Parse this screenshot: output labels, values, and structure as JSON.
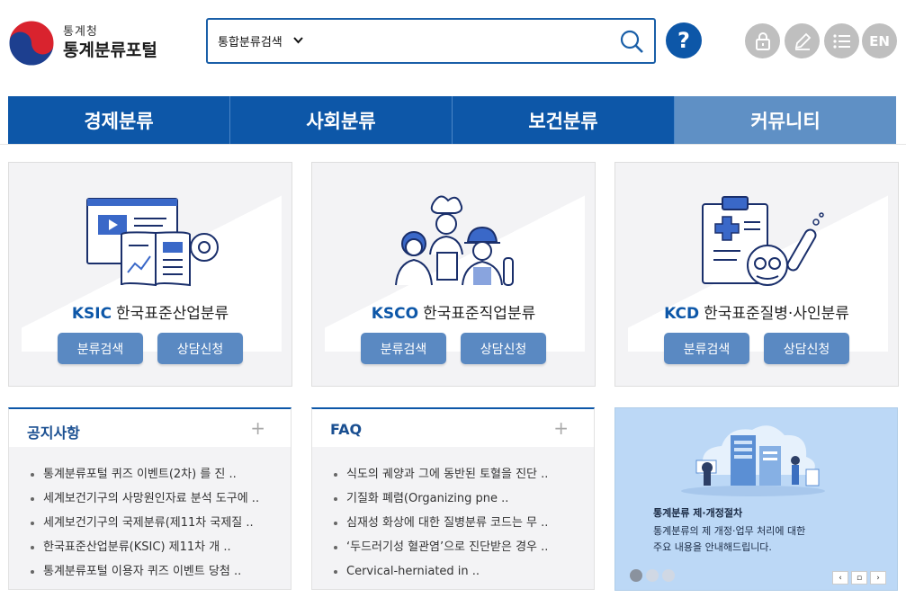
{
  "header": {
    "logo_sub": "통계청",
    "logo_main": "통계분류포털",
    "search": {
      "scope": "통합분류검색",
      "value": "",
      "placeholder": ""
    },
    "help_label": "?",
    "lang_label": "EN"
  },
  "nav": [
    {
      "label": "경제분류"
    },
    {
      "label": "사회분류"
    },
    {
      "label": "보건분류"
    },
    {
      "label": "커뮤니티"
    }
  ],
  "cards": [
    {
      "code": "KSIC",
      "name": "한국표준산업분류",
      "btn1": "분류검색",
      "btn2": "상담신청",
      "icon": "industry-icon"
    },
    {
      "code": "KSCO",
      "name": "한국표준직업분류",
      "btn1": "분류검색",
      "btn2": "상담신청",
      "icon": "occupation-icon"
    },
    {
      "code": "KCD",
      "name": "한국표준질병·사인분류",
      "btn1": "분류검색",
      "btn2": "상담신청",
      "icon": "medical-icon"
    }
  ],
  "notice": {
    "title": "공지사항",
    "more": "+",
    "items": [
      "통계분류포털 퀴즈 이벤트(2차) 를 진 ..",
      "세계보건기구의 사망원인자료 분석 도구에 ..",
      "세계보건기구의 국제분류(제11차 국제질 ..",
      "한국표준산업분류(KSIC) 제11차 개 ..",
      "통계분류포털 이용자 퀴즈 이벤트 당첨 .."
    ]
  },
  "faq": {
    "title": "FAQ",
    "more": "+",
    "items": [
      "식도의 궤양과 그에 동반된 토혈을 진단 ..",
      "기질화 폐렴(Organizing pne ..",
      "심재성 화상에 대한 질병분류 코드는 무 ..",
      "‘두드러기성 혈관염’으로 진단받은 경우 ..",
      "Cervical-herniated in .."
    ]
  },
  "banner": {
    "title": "통계분류 제·개정절차",
    "desc1": "통계분류의 제 개정·업무 처리에 대한",
    "desc2": "주요 내용을 안내해드립니다.",
    "prev": "‹",
    "pause": "▫",
    "next": "›"
  },
  "colors": {
    "primary": "#0d57a8",
    "nav_active": "#5f90c5",
    "button": "#5a89c2",
    "util": "#bfbfbf"
  }
}
